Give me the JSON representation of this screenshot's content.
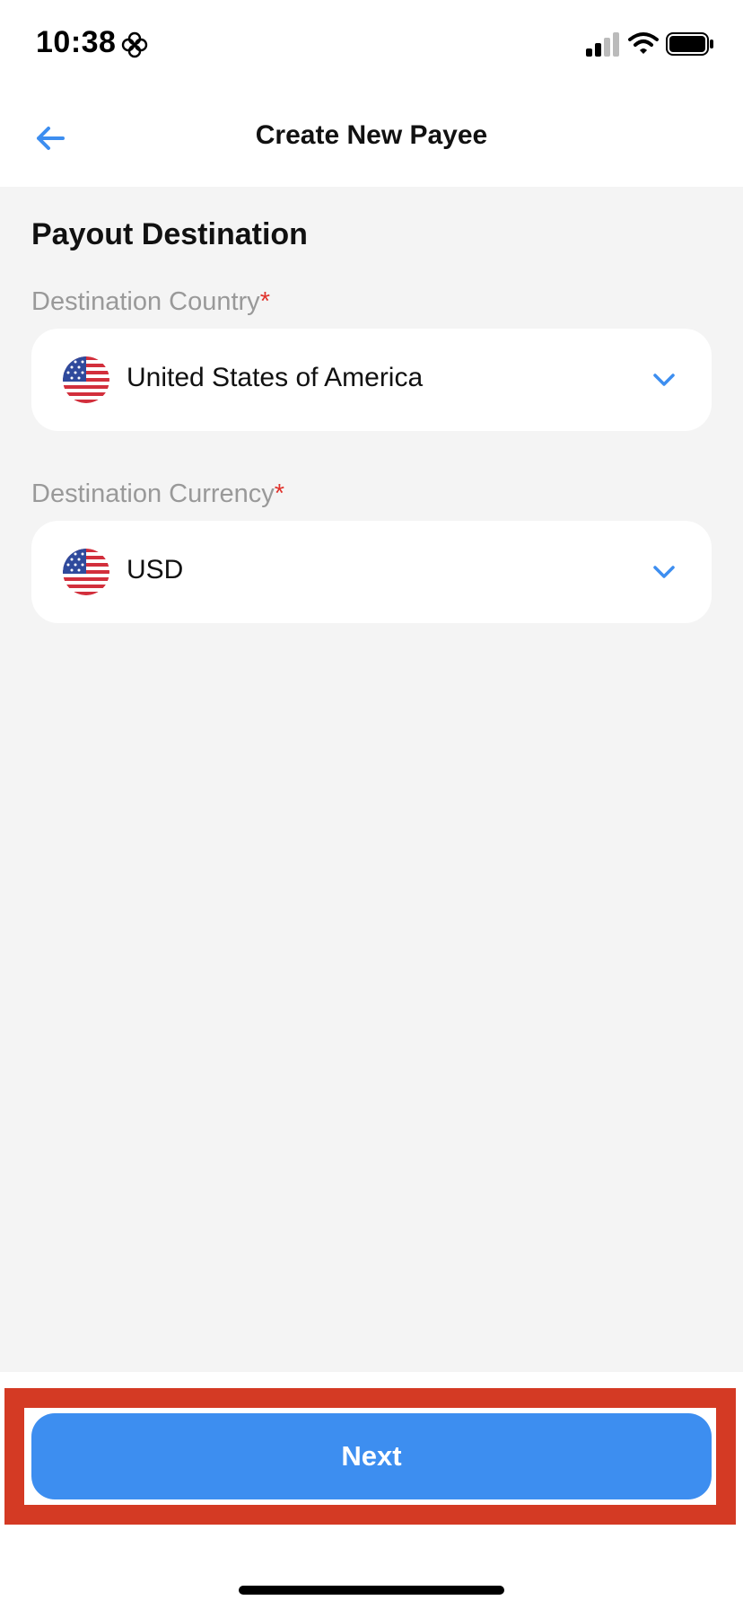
{
  "status_bar": {
    "time": "10:38",
    "icons": [
      "flower-icon",
      "signal-icon",
      "wifi-icon",
      "battery-icon"
    ]
  },
  "header": {
    "back_icon": "arrow-left-icon",
    "title": "Create New Payee"
  },
  "section": {
    "title": "Payout Destination"
  },
  "fields": [
    {
      "label": "Destination Country",
      "required_mark": "*",
      "value": "United States of America",
      "flag_icon": "us-flag-icon",
      "chevron_icon": "chevron-down-icon"
    },
    {
      "label": "Destination Currency",
      "required_mark": "*",
      "value": "USD",
      "flag_icon": "us-flag-icon",
      "chevron_icon": "chevron-down-icon"
    }
  ],
  "footer": {
    "next_label": "Next"
  },
  "colors": {
    "accent": "#3d8ef0",
    "required": "#e0332c",
    "highlight": "#d43a24",
    "label_gray": "#999999",
    "background": "#f4f4f4"
  }
}
